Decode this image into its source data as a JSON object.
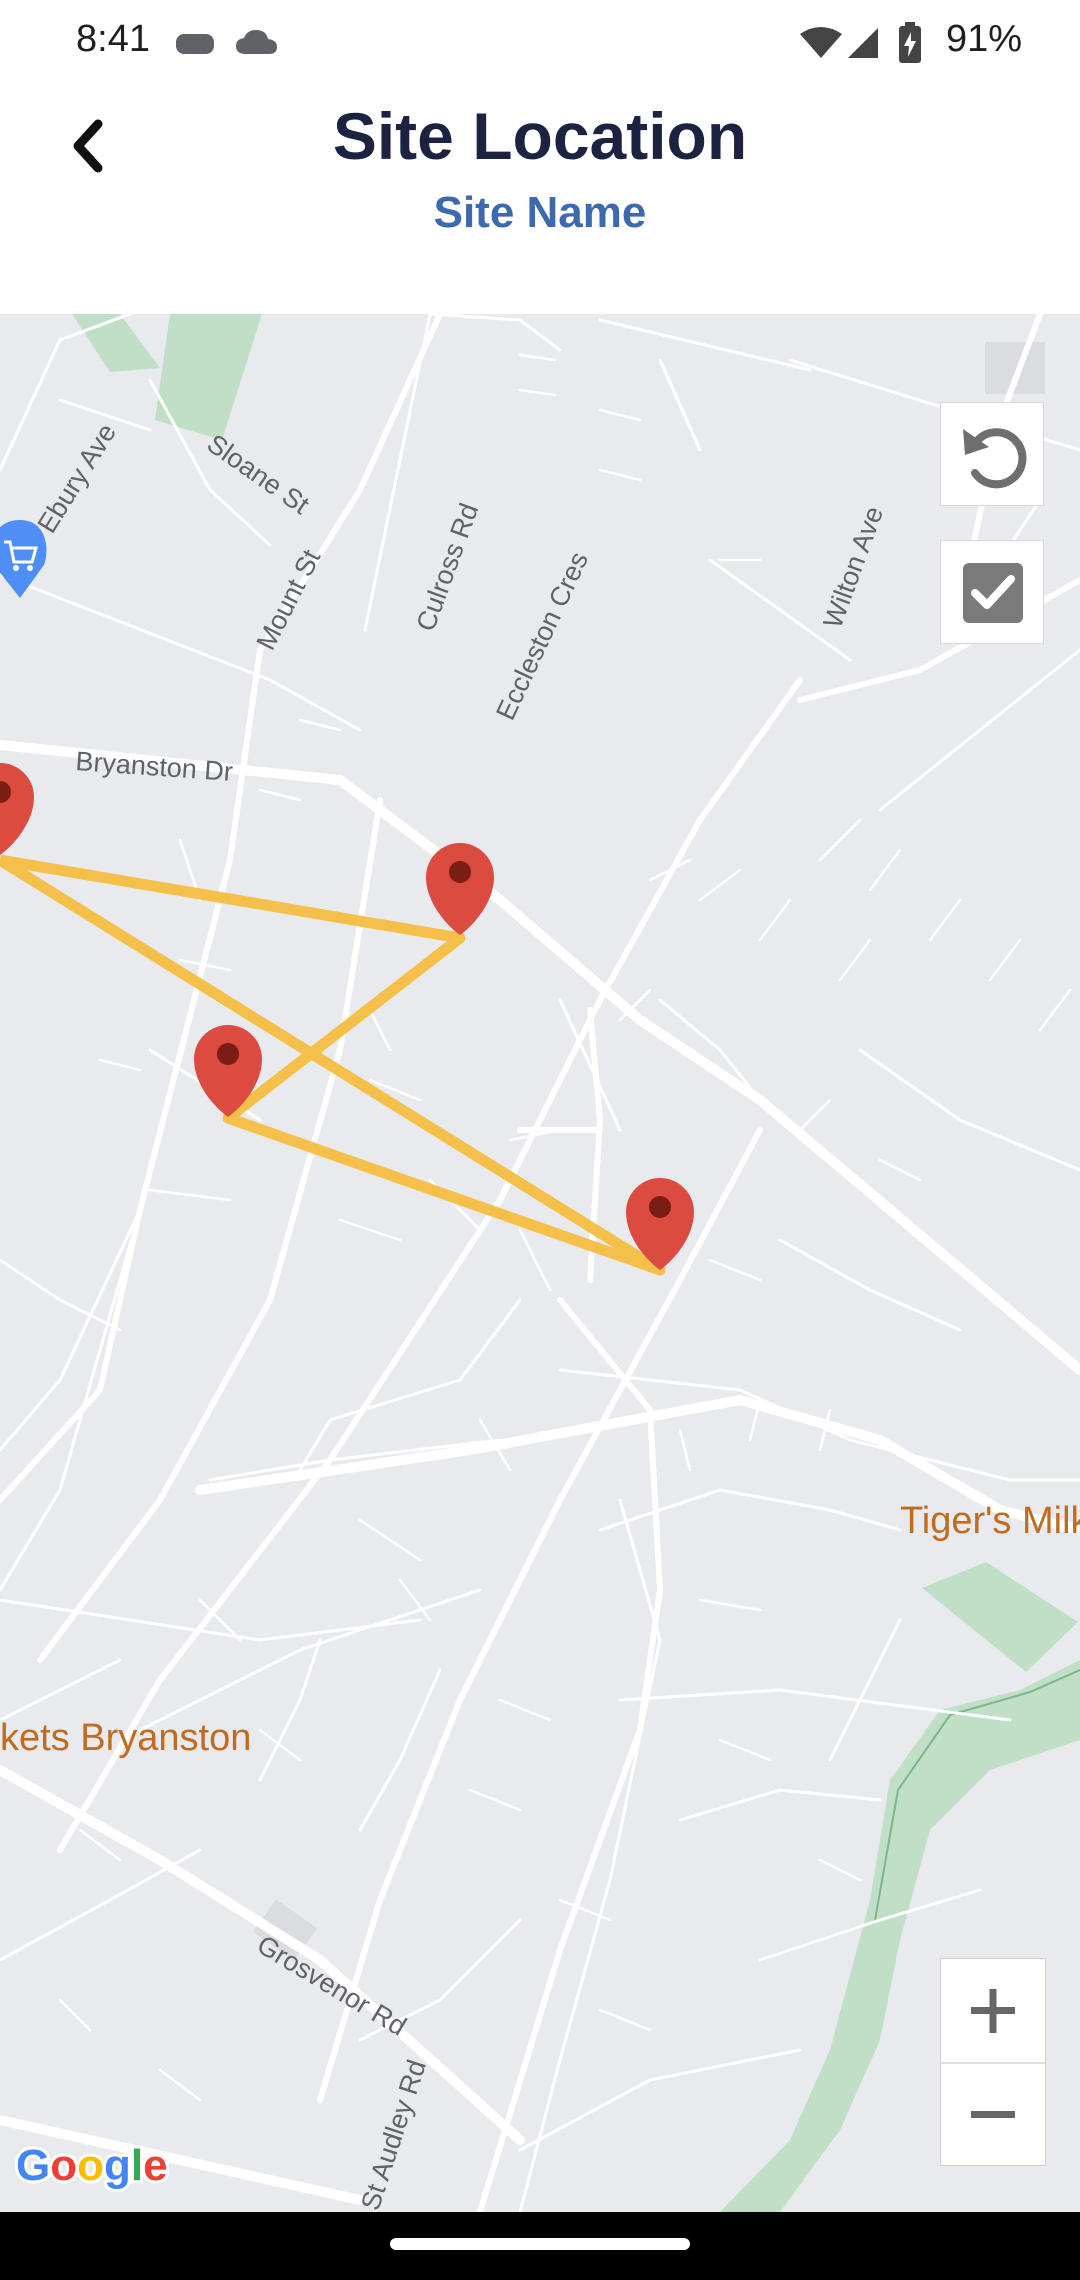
{
  "status_bar": {
    "time": "8:41",
    "battery_percent": "91%",
    "icons": [
      "voicemail-icon",
      "cloud-icon",
      "wifi-icon",
      "cellular-signal-icon",
      "battery-charging-icon"
    ]
  },
  "header": {
    "title": "Site Location",
    "subtitle": "Site Name",
    "back_icon": "chevron-left-icon"
  },
  "map": {
    "controls": {
      "undo_icon": "undo-icon",
      "confirm_icon": "checkbox-icon",
      "zoom_in_icon": "plus-icon",
      "zoom_out_icon": "minus-icon"
    },
    "attribution": "Google",
    "street_labels": [
      "Ebury Ave",
      "Sloane St",
      "Mount St",
      "Culross Rd",
      "Eccleston Cres",
      "Wilton Ave",
      "Bryanston Dr",
      "Grosvenor Rd",
      "St Audley Rd"
    ],
    "poi_labels": [
      "Tiger's Milk",
      "kets Bryanston"
    ],
    "marker_count": 4,
    "colors": {
      "polygon": "#f5c04a",
      "marker": "#db4b3f",
      "poi_text": "#c26a1e",
      "park": "#c0dfc6"
    }
  }
}
